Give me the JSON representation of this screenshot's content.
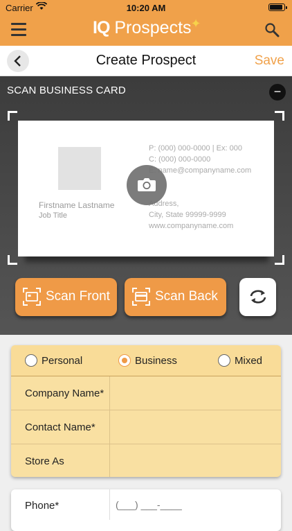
{
  "status": {
    "carrier": "Carrier",
    "time": "10:20 AM"
  },
  "header": {
    "logo_iq": "IQ",
    "logo_rest": "Prospects"
  },
  "nav": {
    "title": "Create Prospect",
    "save_label": "Save"
  },
  "scan": {
    "heading": "SCAN BUSINESS CARD",
    "collapse_label": "−",
    "scan_front_label": "Scan Front",
    "scan_back_label": "Scan Back",
    "card": {
      "name": "Firstname Lastname",
      "job_title": "Job Title",
      "phone": "P: (000) 000-0000 | Ex: 000",
      "cell": "C: (000) 000-0000",
      "email": "E: name@companyname.com",
      "address": "Address,",
      "city": "City, State 99999-9999",
      "website": "www.companyname.com"
    }
  },
  "form": {
    "types": [
      {
        "label": "Personal",
        "selected": false
      },
      {
        "label": "Business",
        "selected": true
      },
      {
        "label": "Mixed",
        "selected": false
      }
    ],
    "company_name_label": "Company Name*",
    "contact_name_label": "Contact Name*",
    "store_as_label": "Store As",
    "phone_label": "Phone*",
    "phone_placeholder": "(___) ___-____"
  },
  "colors": {
    "accent": "#f0a14a",
    "form_bg": "#f9e0a2"
  }
}
